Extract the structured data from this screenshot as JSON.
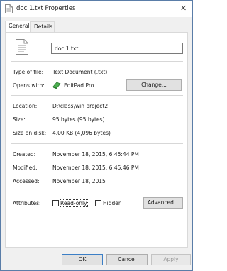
{
  "window": {
    "title": "doc 1.txt Properties"
  },
  "tabs": [
    {
      "label": "General",
      "active": true
    },
    {
      "label": "Details",
      "active": false
    }
  ],
  "general": {
    "filename": "doc 1.txt",
    "type_label": "Type of file:",
    "type_value": "Text Document (.txt)",
    "opens_label": "Opens with:",
    "opens_value": "EditPad Pro",
    "change_button": "Change...",
    "location_label": "Location:",
    "location_value": "D:\\class\\win project2",
    "size_label": "Size:",
    "size_value": "95 bytes (95 bytes)",
    "size_disk_label": "Size on disk:",
    "size_disk_value": "4.00 KB (4,096 bytes)",
    "created_label": "Created:",
    "created_value": "November 18, 2015, 6:45:44 PM",
    "modified_label": "Modified:",
    "modified_value": "November 18, 2015, 6:45:46 PM",
    "accessed_label": "Accessed:",
    "accessed_value": "November 18, 2015",
    "attributes_label": "Attributes:",
    "readonly_label": "Read-only",
    "hidden_label": "Hidden",
    "advanced_button": "Advanced..."
  },
  "footer": {
    "ok": "OK",
    "cancel": "Cancel",
    "apply": "Apply"
  },
  "icons": {
    "title": "text-file-icon",
    "file": "text-file-icon",
    "app": "editpad-pro-icon",
    "close": "close-icon"
  },
  "colors": {
    "window_border": "#5a7da8",
    "default_button_border": "#3c7fc6",
    "app_icon_green": "#4caf50"
  }
}
